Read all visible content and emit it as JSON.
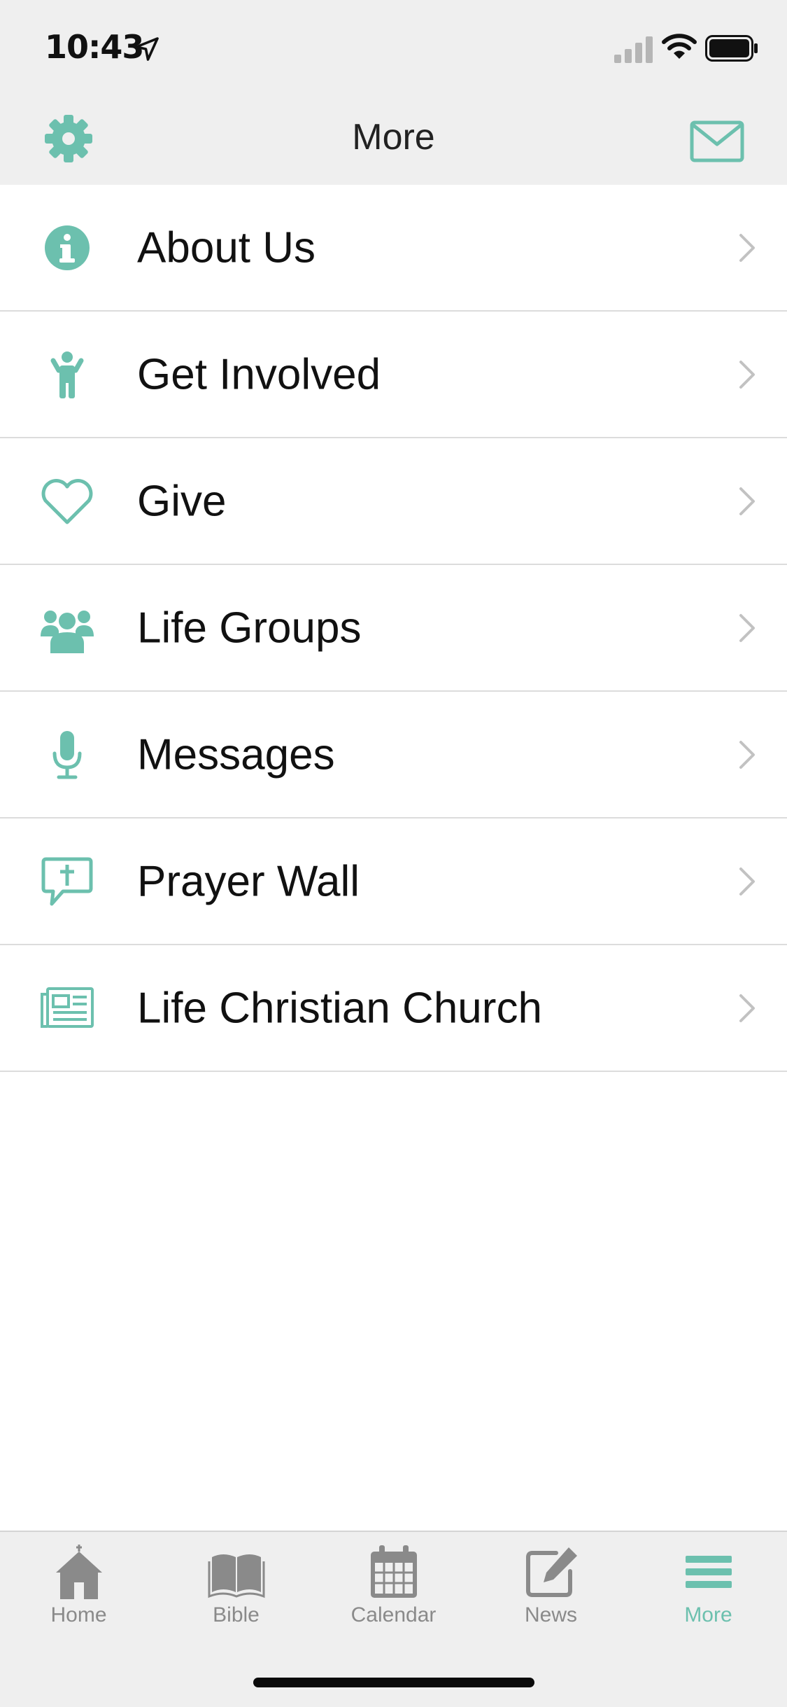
{
  "status_bar": {
    "time": "10:43"
  },
  "nav": {
    "title": "More"
  },
  "menu": [
    {
      "label": "About Us",
      "icon": "info-icon"
    },
    {
      "label": "Get Involved",
      "icon": "person-icon"
    },
    {
      "label": "Give",
      "icon": "heart-icon"
    },
    {
      "label": "Life Groups",
      "icon": "group-icon"
    },
    {
      "label": "Messages",
      "icon": "microphone-icon"
    },
    {
      "label": "Prayer Wall",
      "icon": "prayer-bubble-icon"
    },
    {
      "label": "Life Christian Church",
      "icon": "newspaper-icon"
    }
  ],
  "tabs": [
    {
      "label": "Home",
      "icon": "church-icon"
    },
    {
      "label": "Bible",
      "icon": "book-icon"
    },
    {
      "label": "Calendar",
      "icon": "calendar-icon"
    },
    {
      "label": "News",
      "icon": "edit-icon"
    },
    {
      "label": "More",
      "icon": "menu-icon"
    }
  ],
  "active_tab": "More",
  "colors": {
    "accent": "#6cc0ae",
    "bar_background": "#efefef",
    "inactive": "#8a8a8a"
  }
}
